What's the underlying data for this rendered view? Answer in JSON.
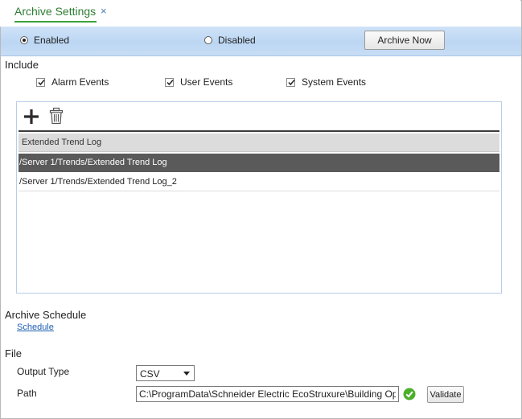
{
  "tab": {
    "title": "Archive Settings",
    "close_glyph": "×",
    "accent_color": "#2e7d32",
    "icon": "close-icon"
  },
  "mode": {
    "enabled_label": "Enabled",
    "disabled_label": "Disabled",
    "selected": "Enabled",
    "archive_now_label": "Archive Now"
  },
  "include": {
    "heading": "Include",
    "options": [
      {
        "label": "Alarm Events",
        "checked": true
      },
      {
        "label": "User Events",
        "checked": true
      },
      {
        "label": "System Events",
        "checked": true
      }
    ]
  },
  "log_list": {
    "toolbar_icons": [
      "add-icon",
      "delete-icon"
    ],
    "column_header": "Extended Trend Log",
    "rows": [
      {
        "path": "/Server 1/Trends/Extended Trend Log",
        "selected": true
      },
      {
        "path": "/Server 1/Trends/Extended Trend Log_2",
        "selected": false
      }
    ]
  },
  "schedule": {
    "heading": "Archive Schedule",
    "link_label": "Schedule"
  },
  "file": {
    "heading": "File",
    "output_type_label": "Output Type",
    "output_type_value": "CSV",
    "path_label": "Path",
    "path_value": "C:\\ProgramData\\Schneider Electric EcoStruxure\\Building Operation",
    "path_status_icon": "checkmark-circle-icon",
    "validate_label": "Validate"
  }
}
